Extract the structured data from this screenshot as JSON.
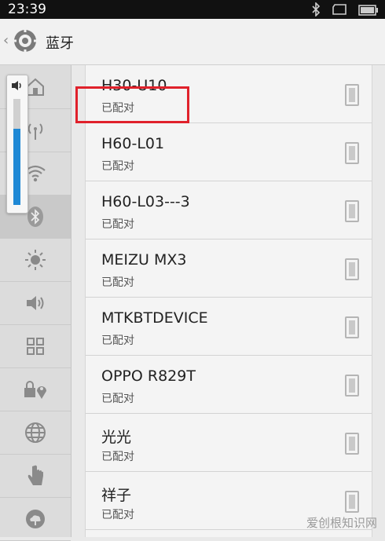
{
  "status_bar": {
    "time": "23:39"
  },
  "action_bar": {
    "title": "蓝牙"
  },
  "sidebar": {
    "items": [
      {
        "icon": "home-icon"
      },
      {
        "icon": "signal-icon"
      },
      {
        "icon": "wifi-icon"
      },
      {
        "icon": "bluetooth-icon",
        "active": true
      },
      {
        "icon": "brightness-icon"
      },
      {
        "icon": "volume-icon"
      },
      {
        "icon": "grid-icon"
      },
      {
        "icon": "lock-location-icon"
      },
      {
        "icon": "globe-icon"
      },
      {
        "icon": "hand-icon"
      },
      {
        "icon": "cloud-icon"
      }
    ]
  },
  "volume": {
    "level": 0.72
  },
  "devices": [
    {
      "name": "H30-U10",
      "status": "已配对"
    },
    {
      "name": "H60-L01",
      "status": "已配对"
    },
    {
      "name": "H60-L03---3",
      "status": "已配对"
    },
    {
      "name": "MEIZU MX3",
      "status": "已配对"
    },
    {
      "name": "MTKBTDEVICE",
      "status": "已配对"
    },
    {
      "name": "OPPO R829T",
      "status": "已配对"
    },
    {
      "name": "光光",
      "status": "已配对"
    },
    {
      "name": "祥子",
      "status": "已配对"
    }
  ],
  "watermark": "爱创根知识网",
  "colors": {
    "highlight": "#e0212b",
    "volume_fill": "#1e88d5"
  }
}
